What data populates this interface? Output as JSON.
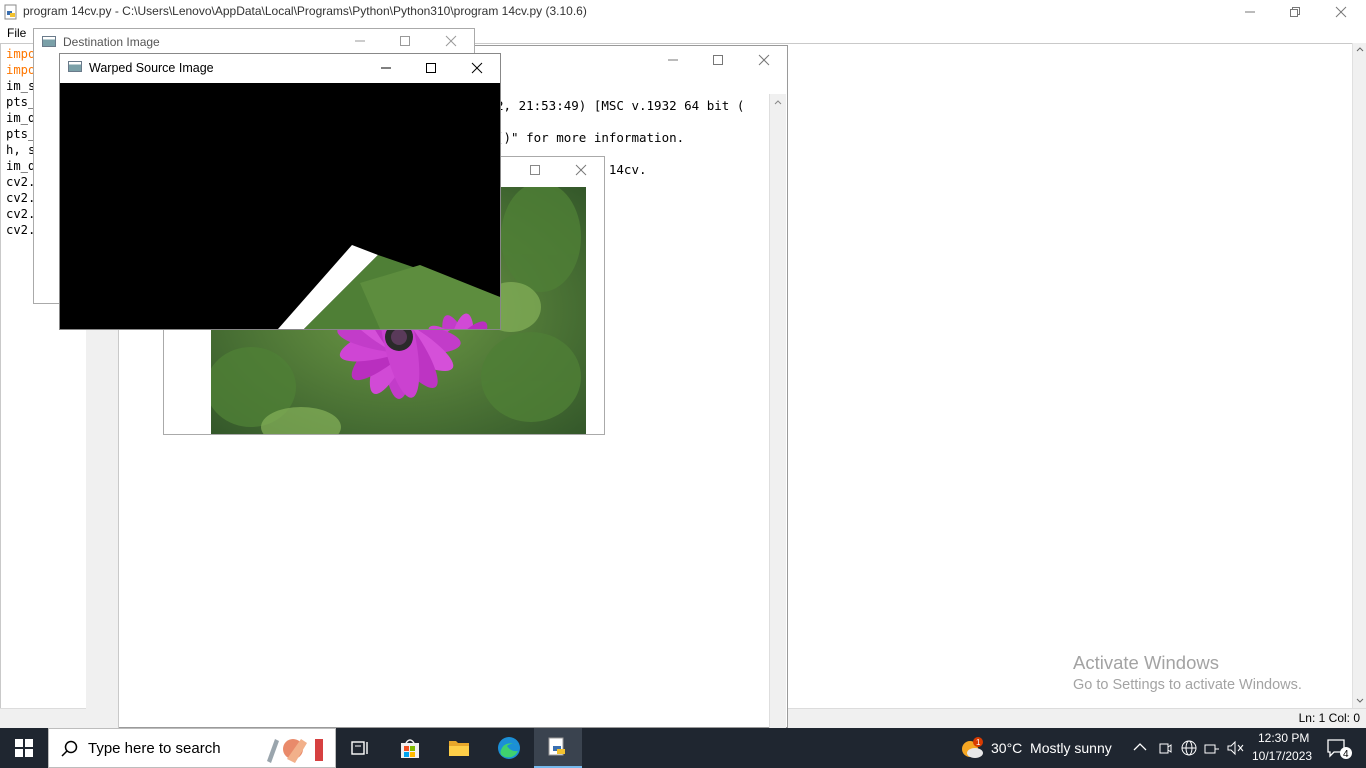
{
  "editor": {
    "title": "program 14cv.py - C:\\Users\\Lenovo\\AppData\\Local\\Programs\\Python\\Python310\\program 14cv.py (3.10.6)",
    "menu_file": "File",
    "code_lines": [
      "impo",
      "impo",
      "im_s",
      "pts_",
      "im_d",
      "pts_",
      "h, s",
      "im_d",
      "cv2.",
      "cv2.",
      "cv2.",
      "cv2."
    ],
    "status": "Ln: 1    Col: 0"
  },
  "shell": {
    "lines": [
      "2, 21:53:49) [MSC v.1932 64 bit (",
      "",
      "()\" for more information.",
      "",
      "hon310\\program 14cv."
    ]
  },
  "windows": {
    "destination_title": "Destination Image",
    "warped_title": "Warped Source Image"
  },
  "watermark": {
    "line1": "Activate Windows",
    "line2": "Go to Settings to activate Windows."
  },
  "taskbar": {
    "search_placeholder": "Type here to search",
    "weather": "30°C  Mostly sunny",
    "time": "12:30 PM",
    "date": "10/17/2023",
    "notification_count": "4",
    "weather_badge": "1"
  },
  "colors": {
    "taskbar_bg": "#1f2630",
    "keyword": "#ff7700",
    "flower": "#c23cc9",
    "leaf": "#4c7a32"
  }
}
